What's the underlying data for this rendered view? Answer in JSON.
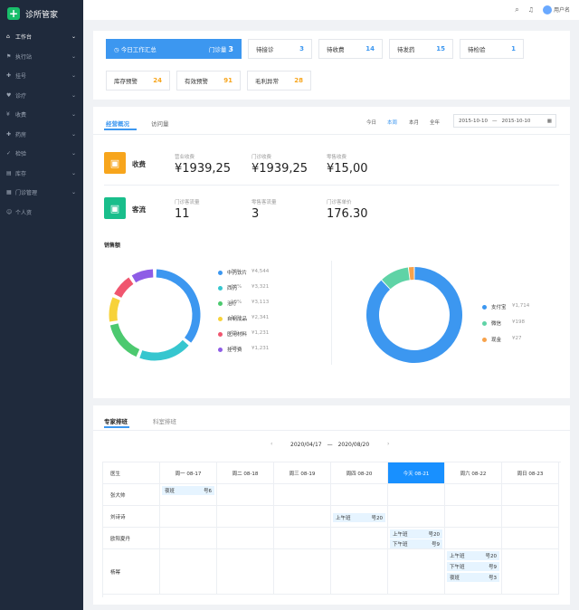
{
  "app": {
    "name": "诊所管家",
    "user": "用户名"
  },
  "sidebar": {
    "items": [
      {
        "label": "工作台",
        "icon": "dashboard-icon"
      },
      {
        "label": "执行站",
        "icon": "station-icon"
      },
      {
        "label": "挂号",
        "icon": "register-icon"
      },
      {
        "label": "诊疗",
        "icon": "diagnosis-icon"
      },
      {
        "label": "收费",
        "icon": "fee-icon"
      },
      {
        "label": "药房",
        "icon": "pharmacy-icon"
      },
      {
        "label": "检验",
        "icon": "lab-icon"
      },
      {
        "label": "库存",
        "icon": "inventory-icon"
      },
      {
        "label": "门诊管理",
        "icon": "clinic-icon"
      },
      {
        "label": "个人资",
        "icon": "user-icon"
      }
    ]
  },
  "stats": {
    "summary": {
      "label": "今日工作汇总",
      "sub": "门诊量",
      "value": "3"
    },
    "row1": [
      {
        "label": "待接诊",
        "value": "3"
      },
      {
        "label": "待收费",
        "value": "14"
      },
      {
        "label": "待发药",
        "value": "15"
      },
      {
        "label": "待检验",
        "value": "1"
      }
    ],
    "row2": [
      {
        "label": "库存预警",
        "value": "24"
      },
      {
        "label": "有效预警",
        "value": "91"
      },
      {
        "label": "毛利异常",
        "value": "28"
      }
    ]
  },
  "overview": {
    "tabs": [
      "经营概况",
      "访问量"
    ],
    "periods": [
      "今日",
      "本周",
      "本月",
      "全年"
    ],
    "date_from": "2015-10-10",
    "date_sep": "—",
    "date_to": "2015-10-10",
    "income": {
      "title": "收费",
      "items": [
        {
          "label": "营业收费",
          "value": "¥1939,25"
        },
        {
          "label": "门诊收费",
          "value": "¥1939,25"
        },
        {
          "label": "零售收费",
          "value": "¥15,00"
        }
      ]
    },
    "flow": {
      "title": "客流",
      "items": [
        {
          "label": "门诊客流量",
          "value": "11"
        },
        {
          "label": "零售客流量",
          "value": "3"
        },
        {
          "label": "门诊客单价",
          "value": "176.30"
        }
      ]
    },
    "sales_title": "销售额"
  },
  "chart_data": [
    {
      "type": "pie",
      "donut": true,
      "categories": [
        "中药饮片",
        "西药",
        "治疗",
        "自制成品",
        "医用材料",
        "挂号费"
      ],
      "percents": [
        36,
        20,
        16,
        10,
        9,
        9
      ],
      "values": [
        "¥4,544",
        "¥3,321",
        "¥3,113",
        "¥2,341",
        "¥1,231",
        "¥1,231"
      ],
      "colors": [
        "#3c97f0",
        "#36c6cf",
        "#4cc96f",
        "#f7d23a",
        "#f0566f",
        "#8e5ce6"
      ]
    },
    {
      "type": "pie",
      "donut": true,
      "categories": [
        "支付宝",
        "微信",
        "现金"
      ],
      "percents": [
        88,
        10,
        2
      ],
      "values": [
        "¥1,714",
        "¥198",
        "¥27"
      ],
      "colors": [
        "#3c97f0",
        "#5fd3a6",
        "#f7a24b"
      ]
    }
  ],
  "schedule": {
    "tabs": [
      "专家排班",
      "科室排班"
    ],
    "range_from": "2020/04/17",
    "range_sep": "—",
    "range_to": "2020/08/20",
    "prev": "‹",
    "next": "›",
    "header": [
      "医生",
      "周一 08-17",
      "周二 08-18",
      "周三 08-19",
      "周四 08-20",
      "今天 08-21",
      "周六 08-22",
      "周日 08-23"
    ],
    "doctors": [
      "张大帅",
      "刘诗诗",
      "欧阳夏丹",
      "杨幂"
    ],
    "shifts": [
      {
        "name": "夜班",
        "no": "号6"
      },
      {
        "name": "上午班",
        "no": "号20"
      },
      {
        "name": "上午班",
        "no": "号20"
      },
      {
        "name": "下午班",
        "no": "号9"
      },
      {
        "name": "上午班",
        "no": "号20"
      },
      {
        "name": "下午班",
        "no": "号9"
      },
      {
        "name": "夜班",
        "no": "号3"
      }
    ]
  }
}
